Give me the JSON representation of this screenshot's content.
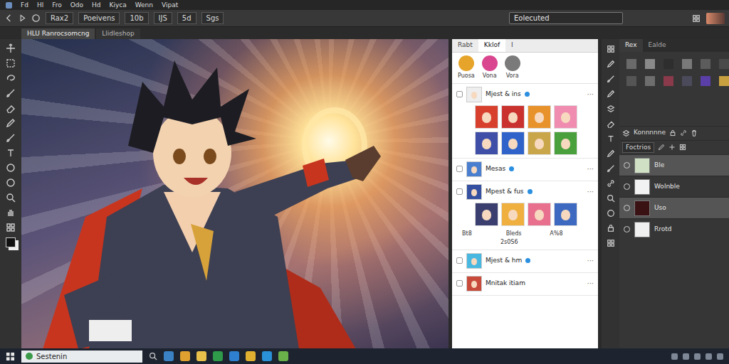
{
  "menu_bar": {
    "items": [
      "Fd",
      "Hl",
      "Fro",
      "Odo",
      "Hd",
      "Kiyca",
      "Wenn",
      "Vipat"
    ]
  },
  "options_bar": {
    "fields": [
      "Rax2",
      "Poeivens",
      "10b",
      "IJS",
      "5d",
      "Sgs"
    ],
    "search": {
      "value": "Eolecuted"
    }
  },
  "document_tabs": [
    {
      "label": "HLU Ranrocsomcng",
      "selected": true
    },
    {
      "label": "Llidleshop",
      "selected": false
    }
  ],
  "feed_panel": {
    "tabs": [
      {
        "label": "Rabt",
        "selected": false
      },
      {
        "label": "Kklof",
        "selected": true
      },
      {
        "label": "I",
        "selected": false
      }
    ],
    "filters": [
      {
        "label": "Puosa",
        "color": "#e6a52a"
      },
      {
        "label": "Vona",
        "color": "#d9468f"
      },
      {
        "label": "Vora",
        "color": "#7a7a7a"
      }
    ],
    "menu_glyph": "···",
    "posts": [
      {
        "author": "Mjest & ins",
        "verified": true,
        "color": "#eeeeee",
        "avatars": [
          {
            "color": "#d8402e"
          },
          {
            "color": "#c9322f"
          },
          {
            "color": "#e8922c"
          },
          {
            "color": "#f08cb0"
          },
          {
            "color": "#3f4fa8"
          },
          {
            "color": "#2f63c9"
          },
          {
            "color": "#caa64a"
          },
          {
            "color": "#4aa03c"
          }
        ],
        "stats": [],
        "note": ""
      },
      {
        "author": "Mesas",
        "verified": true,
        "color": "#4a7fd0",
        "avatars": [],
        "stats": [],
        "note": ""
      },
      {
        "author": "Mpest & fus",
        "verified": true,
        "color": "#3550a0",
        "avatars": [
          {
            "color": "#3a3f70"
          },
          {
            "color": "#f0b040"
          },
          {
            "color": "#e8708e"
          },
          {
            "color": "#3d6ac0"
          }
        ],
        "stats": [
          "Bt8",
          "Bleds",
          "A%8"
        ],
        "note": "2s0S6"
      },
      {
        "author": "Mjest & hm",
        "verified": true,
        "color": "#49b8e0",
        "avatars": [],
        "stats": [],
        "note": ""
      },
      {
        "author": "Mnitak itiam",
        "verified": false,
        "color": "#c84a3a",
        "avatars": [],
        "stats": [],
        "note": ""
      }
    ]
  },
  "right_panel": {
    "tabs": [
      {
        "label": "Rex",
        "selected": true
      },
      {
        "label": "Ealde",
        "selected": false
      }
    ],
    "swatches": [
      {
        "color": "#6a6a6a"
      },
      {
        "color": "#8a8a8a"
      },
      {
        "color": "#2e2e2e"
      },
      {
        "color": "#7a7a7a"
      },
      {
        "color": "#5c5c5c"
      },
      {
        "color": "#4a4a4a"
      },
      {
        "color": "#555555"
      },
      {
        "color": "#6e6e6e"
      },
      {
        "color": "#8a3a4a"
      },
      {
        "color": "#4a4a5a"
      },
      {
        "color": "#5b3fa8"
      },
      {
        "color": "#c8a040"
      }
    ],
    "layers_title": "Konnnnne",
    "filter": "Foctrios",
    "layers": [
      {
        "name": "Ble",
        "visible": true,
        "selected": true,
        "color": "#cfe0c4"
      },
      {
        "name": "Wolnble",
        "visible": true,
        "selected": false,
        "color": "#f2f2f2"
      },
      {
        "name": "Uso",
        "visible": true,
        "selected": true,
        "color": "#3a1214"
      },
      {
        "name": "Rrotd",
        "visible": true,
        "selected": false,
        "color": "#f0f0f0"
      }
    ]
  },
  "taskbar": {
    "search": "Sestenin",
    "apps": [
      {
        "color": "#3b82c4"
      },
      {
        "color": "#e0a030"
      },
      {
        "color": "#e8c04a"
      },
      {
        "color": "#2e9a4a"
      },
      {
        "color": "#2f7fd0"
      },
      {
        "color": "#e0b030"
      },
      {
        "color": "#2a90d8"
      },
      {
        "color": "#6ab04a"
      }
    ]
  }
}
